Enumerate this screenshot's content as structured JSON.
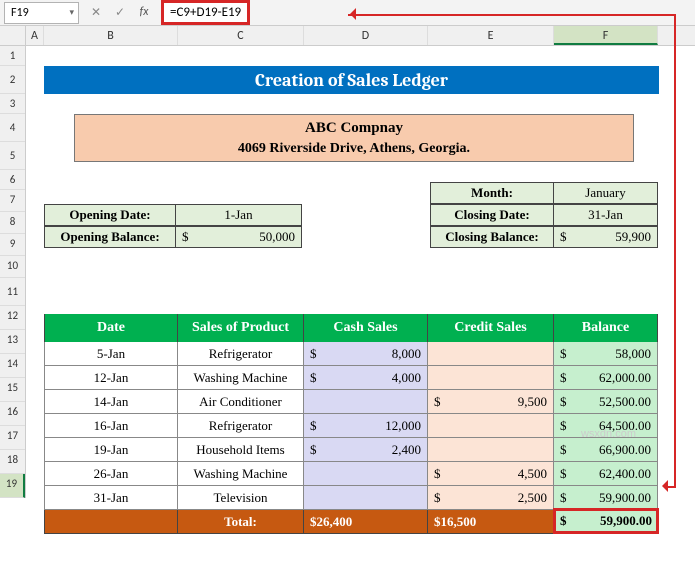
{
  "nameBox": "F19",
  "formula": "=C9+D19-E19",
  "columns": [
    "A",
    "B",
    "C",
    "D",
    "E",
    "F"
  ],
  "rows": [
    "1",
    "2",
    "3",
    "4",
    "5",
    "6",
    "7",
    "8",
    "9",
    "10",
    "11",
    "12",
    "13",
    "14",
    "15",
    "16",
    "17",
    "18",
    "19"
  ],
  "title": "Creation of Sales Ledger",
  "company": {
    "name": "ABC Compnay",
    "address": "4069 Riverside Drive, Athens, Georgia."
  },
  "summaryRight": {
    "r1": {
      "label": "Month:",
      "val": "January"
    },
    "r2": {
      "label": "Closing Date:",
      "val": "31-Jan"
    },
    "r3": {
      "label": "Closing Balance:",
      "cur": "$",
      "val": "59,900"
    }
  },
  "summaryLeft": {
    "r1": {
      "label": "Opening Date:",
      "val": "1-Jan"
    },
    "r2": {
      "label": "Opening Balance:",
      "cur": "$",
      "val": "50,000"
    }
  },
  "headers": {
    "b": "Date",
    "c": "Sales of Product",
    "d": "Cash Sales",
    "e": "Credit Sales",
    "f": "Balance"
  },
  "data": [
    {
      "date": "5-Jan",
      "prod": "Refrigerator",
      "cash": "8,000",
      "credit": "",
      "bal": "58,000"
    },
    {
      "date": "12-Jan",
      "prod": "Washing Machine",
      "cash": "4,000",
      "credit": "",
      "bal": "62,000.00"
    },
    {
      "date": "14-Jan",
      "prod": "Air Conditioner",
      "cash": "",
      "credit": "9,500",
      "bal": "52,500.00"
    },
    {
      "date": "16-Jan",
      "prod": "Refrigerator",
      "cash": "12,000",
      "credit": "",
      "bal": "64,500.00"
    },
    {
      "date": "19-Jan",
      "prod": "Household Items",
      "cash": "2,400",
      "credit": "",
      "bal": "66,900.00"
    },
    {
      "date": "26-Jan",
      "prod": "Washing Machine",
      "cash": "",
      "credit": "4,500",
      "bal": "62,400.00"
    },
    {
      "date": "31-Jan",
      "prod": "Television",
      "cash": "",
      "credit": "2,500",
      "bal": "59,900.00"
    }
  ],
  "total": {
    "label": "Total:",
    "cash": "26,400",
    "credit": "16,500",
    "bal": "59,900.00"
  },
  "watermark": "wsxdn.com",
  "dollarSign": "$",
  "icons": {
    "cancel": "✕",
    "confirm": "✓",
    "fx": "fx",
    "dropdown": "▾"
  }
}
